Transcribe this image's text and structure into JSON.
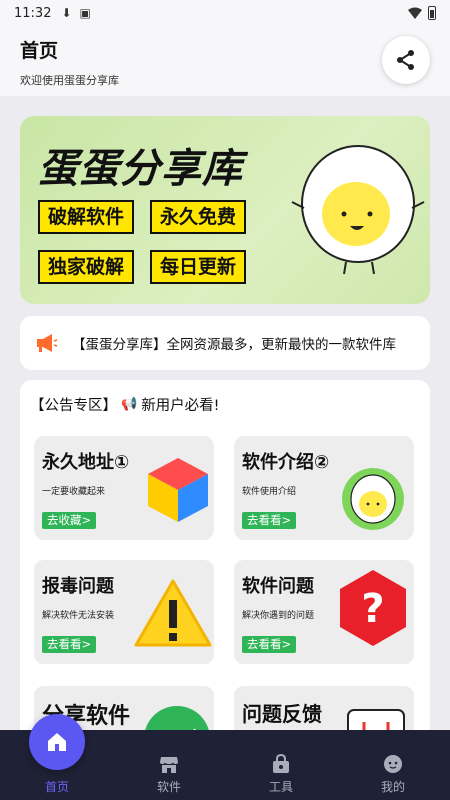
{
  "status_bar": {
    "time": "11:32"
  },
  "header": {
    "title": "首页",
    "subtitle": "欢迎使用蛋蛋分享库"
  },
  "banner": {
    "title": "蛋蛋分享库",
    "tags": [
      "破解软件",
      "永久免费",
      "独家破解",
      "每日更新"
    ]
  },
  "notice": {
    "text": "【蛋蛋分享库】全网资源最多，更新最快的一款软件库"
  },
  "announcements": {
    "title": "【公告专区】",
    "subtitle": "新用户必看!",
    "cards": [
      {
        "title": "永久地址①",
        "desc": "一定要收藏起来",
        "button": "去收藏>"
      },
      {
        "title": "软件介绍②",
        "desc": "软件使用介绍",
        "button": "去看看>"
      },
      {
        "title": "报毒问题",
        "desc": "解决软件无法安装",
        "button": "去看看>"
      },
      {
        "title": "软件问题",
        "desc": "解决你遇到的问题",
        "button": "去看看>"
      },
      {
        "title": "分享软件",
        "desc": "",
        "button": ""
      },
      {
        "title": "问题反馈",
        "desc": "",
        "button": ""
      }
    ]
  },
  "bottom_nav": {
    "items": [
      {
        "label": "首页",
        "icon": "home-icon"
      },
      {
        "label": "软件",
        "icon": "store-icon"
      },
      {
        "label": "工具",
        "icon": "lock-bag-icon"
      },
      {
        "label": "我的",
        "icon": "profile-icon"
      }
    ]
  },
  "colors": {
    "accent": "#5b57f2",
    "nav_bg": "#1f2236",
    "tag_yellow": "#ffe500",
    "button_green": "#2fb457"
  }
}
